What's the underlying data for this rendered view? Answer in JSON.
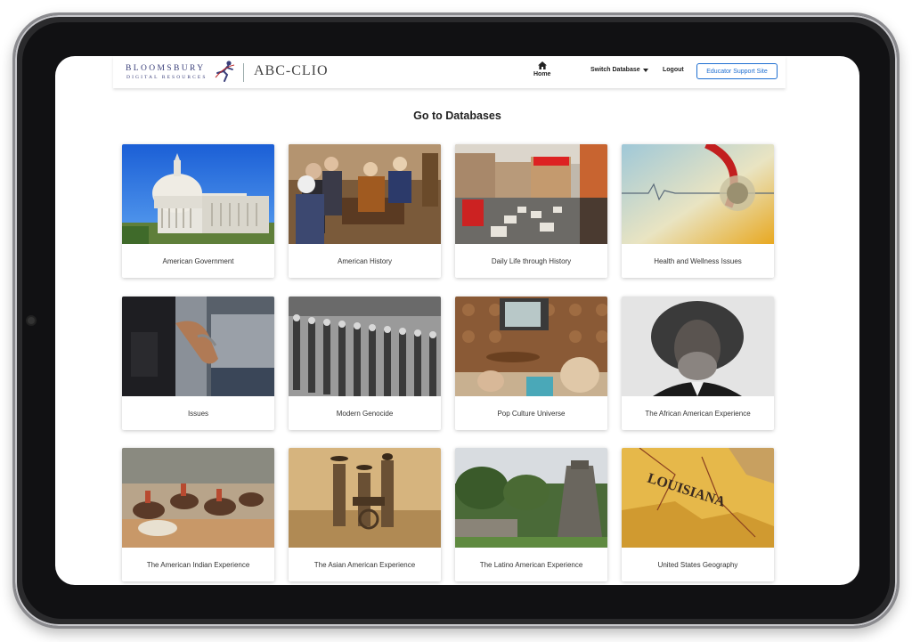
{
  "header": {
    "bloomsbury_line1": "BLOOMSBURY",
    "bloomsbury_line2": "DIGITAL RESOURCES",
    "brand": "ABC-CLIO",
    "home_label": "Home",
    "switch_label": "Switch Database",
    "logout_label": "Logout",
    "educator_label": "Educator Support Site"
  },
  "main": {
    "title": "Go to Databases",
    "cards": [
      {
        "label": "American Government"
      },
      {
        "label": "American History"
      },
      {
        "label": "Daily Life through History"
      },
      {
        "label": "Health and Wellness Issues"
      },
      {
        "label": "Issues"
      },
      {
        "label": "Modern Genocide"
      },
      {
        "label": "Pop Culture Universe"
      },
      {
        "label": "The African American Experience"
      },
      {
        "label": "The American Indian Experience"
      },
      {
        "label": "The Asian American Experience"
      },
      {
        "label": "The Latino American Experience"
      },
      {
        "label": "United States Geography"
      }
    ]
  },
  "colors": {
    "accent": "#1f6fd1",
    "device_frame": "#2a2a2c"
  },
  "icons": [
    "home-icon",
    "caret-down-icon",
    "runner-logo-icon"
  ]
}
